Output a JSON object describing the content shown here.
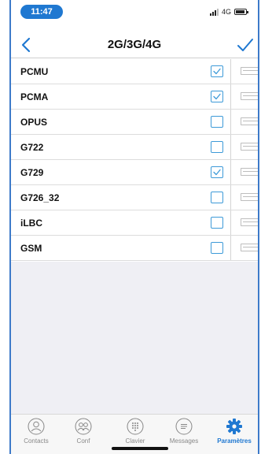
{
  "status_bar": {
    "time": "11:47",
    "network": "4G"
  },
  "nav": {
    "title": "2G/3G/4G",
    "back_icon": "chevron-left-icon",
    "confirm_icon": "checkmark-icon",
    "accent_color": "#1f78d1"
  },
  "codecs": [
    {
      "name": "PCMU",
      "checked": true
    },
    {
      "name": "PCMA",
      "checked": true
    },
    {
      "name": "OPUS",
      "checked": false
    },
    {
      "name": "G722",
      "checked": false
    },
    {
      "name": "G729",
      "checked": true
    },
    {
      "name": "G726_32",
      "checked": false
    },
    {
      "name": "iLBC",
      "checked": false
    },
    {
      "name": "GSM",
      "checked": false
    }
  ],
  "tabs": [
    {
      "label": "Contacts",
      "icon": "person-icon",
      "active": false
    },
    {
      "label": "Conf",
      "icon": "group-icon",
      "active": false
    },
    {
      "label": "Clavier",
      "icon": "keypad-icon",
      "active": false
    },
    {
      "label": "Messages",
      "icon": "chat-bubble-icon",
      "active": false
    },
    {
      "label": "Paramètres",
      "icon": "gear-icon",
      "active": true
    }
  ]
}
